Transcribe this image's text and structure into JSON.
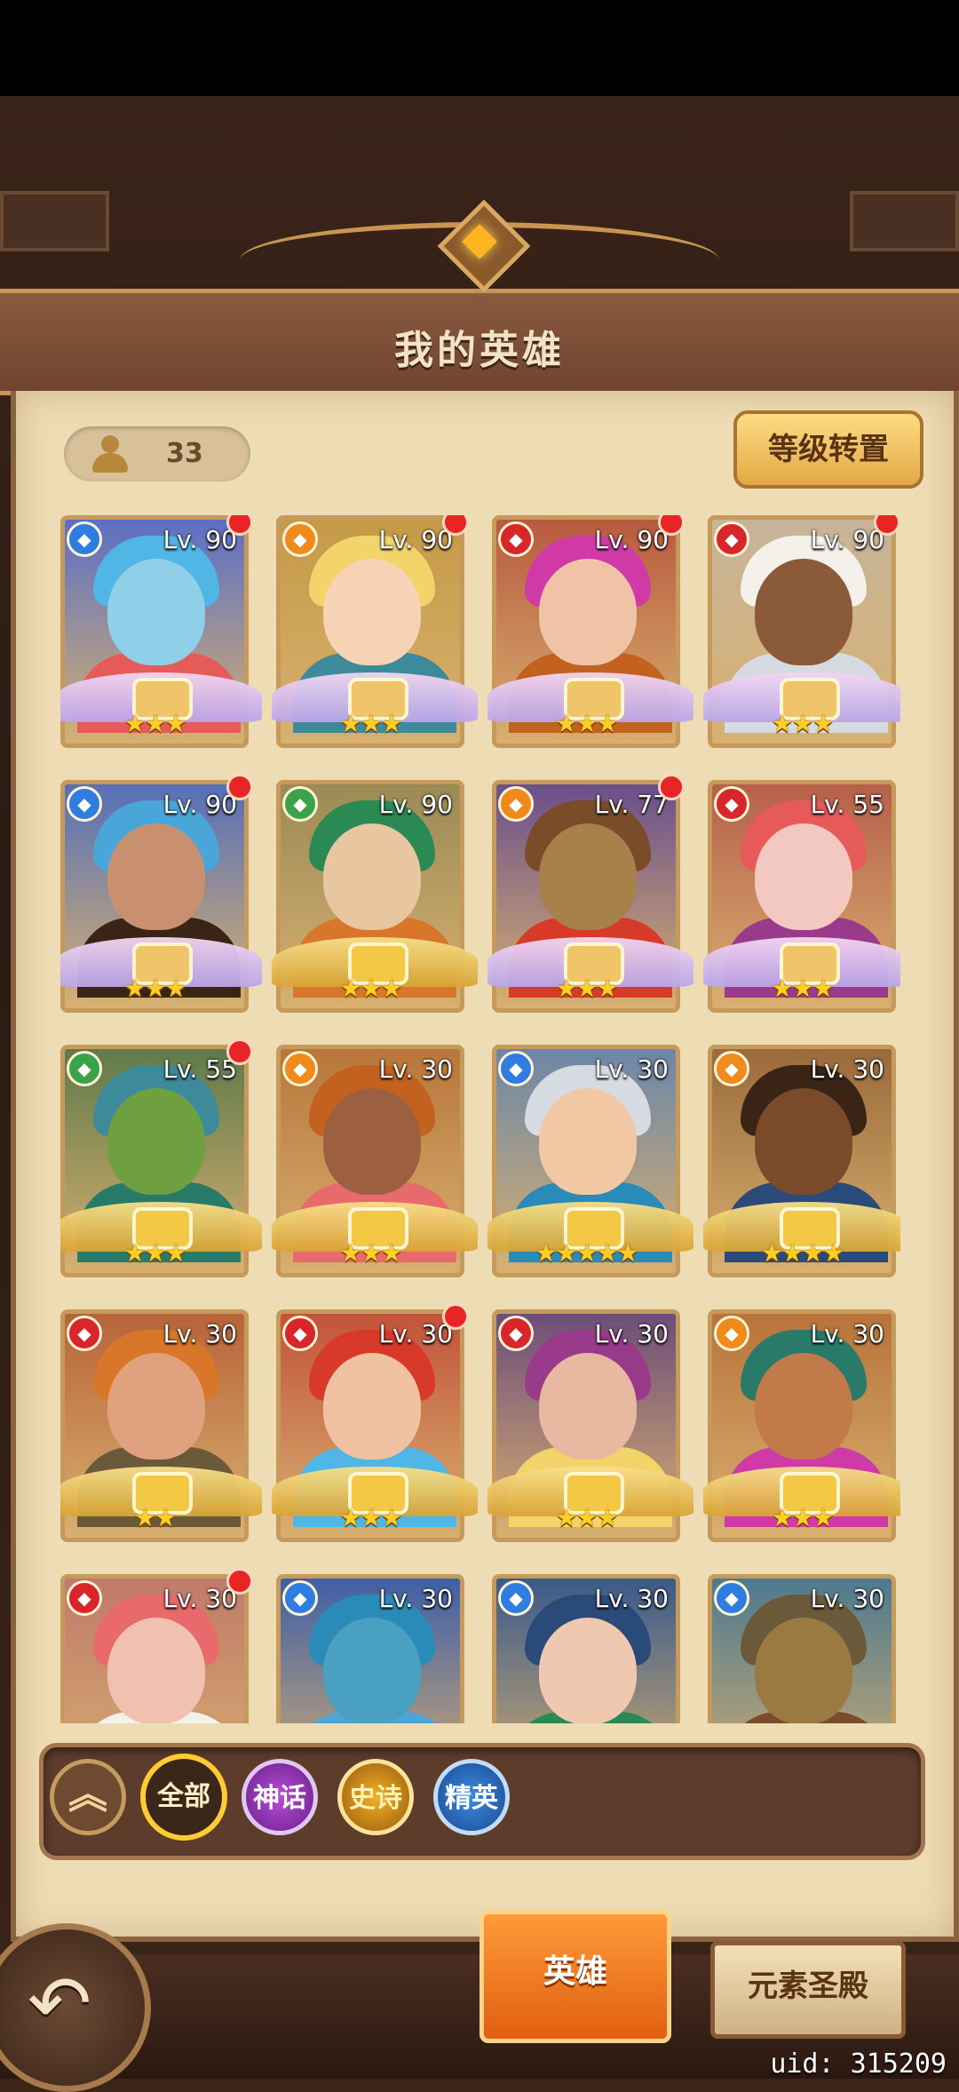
{
  "header": {
    "title": "我的英雄"
  },
  "toolbar": {
    "hero_count": "33",
    "level_transfer_label": "等级转置"
  },
  "colors": {
    "element_blue": "#2f7de0",
    "element_orange": "#f08a1a",
    "element_red": "#d8262a",
    "element_green": "#3aa34a"
  },
  "heroes": [
    {
      "level": "Lv. 90",
      "stars": "★★★",
      "element_icon": "◆",
      "element": "blue"
    },
    {
      "level": "Lv. 90",
      "stars": "★★★",
      "element_icon": "◆",
      "element": "orange"
    },
    {
      "level": "Lv. 90",
      "stars": "★★★",
      "element_icon": "◆",
      "element": "red"
    },
    {
      "level": "Lv. 90",
      "stars": "★★★",
      "element_icon": "◆",
      "element": "red"
    },
    {
      "level": "Lv. 90",
      "stars": "★★★",
      "element_icon": "◆",
      "element": "blue"
    },
    {
      "level": "Lv. 90",
      "stars": "★★★",
      "element_icon": "◆",
      "element": "green"
    },
    {
      "level": "Lv. 77",
      "stars": "★★★",
      "element_icon": "◆",
      "element": "orange"
    },
    {
      "level": "Lv. 55",
      "stars": "★★★",
      "element_icon": "◆",
      "element": "red"
    },
    {
      "level": "Lv. 55",
      "stars": "★★★",
      "element_icon": "◆",
      "element": "green"
    },
    {
      "level": "Lv. 30",
      "stars": "★★★",
      "element_icon": "◆",
      "element": "orange"
    },
    {
      "level": "Lv. 30",
      "stars": "★★★★★",
      "element_icon": "◆",
      "element": "blue"
    },
    {
      "level": "Lv. 30",
      "stars": "★★★★",
      "element_icon": "◆",
      "element": "orange"
    },
    {
      "level": "Lv. 30",
      "stars": "★★",
      "element_icon": "◆",
      "element": "red"
    },
    {
      "level": "Lv. 30",
      "stars": "★★★",
      "element_icon": "◆",
      "element": "red"
    },
    {
      "level": "Lv. 30",
      "stars": "★★★",
      "element_icon": "◆",
      "element": "red"
    },
    {
      "level": "Lv. 30",
      "stars": "★★★",
      "element_icon": "◆",
      "element": "orange"
    },
    {
      "level": "Lv. 30",
      "stars": "",
      "element_icon": "◆",
      "element": "red"
    },
    {
      "level": "Lv. 30",
      "stars": "",
      "element_icon": "◆",
      "element": "blue"
    },
    {
      "level": "Lv. 30",
      "stars": "",
      "element_icon": "◆",
      "element": "blue"
    },
    {
      "level": "Lv. 30",
      "stars": "",
      "element_icon": "◆",
      "element": "blue"
    }
  ],
  "filters": {
    "collapse_icon": "︽",
    "all": "全部",
    "myth": "神话",
    "epic": "史诗",
    "elite": "精英"
  },
  "nav": {
    "back_icon": "↶",
    "tab_hero": "英雄",
    "tab_temple": "元素圣殿"
  },
  "footer": {
    "uid": "uid: 315209"
  }
}
